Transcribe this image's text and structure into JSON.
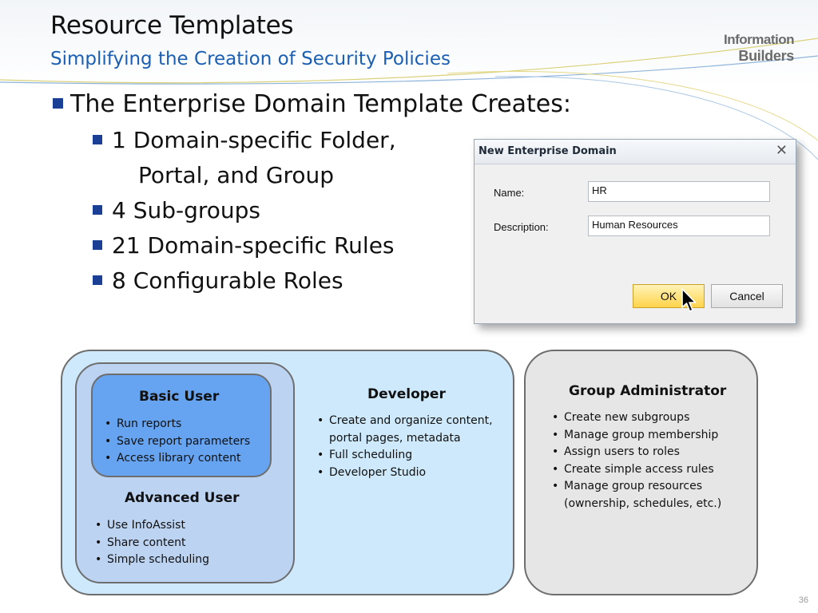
{
  "slide": {
    "title": "Resource Templates",
    "subtitle": "Simplifying the Creation of Security Policies",
    "logo": {
      "line1": "Information",
      "line2": "Builders"
    },
    "page_number": "36",
    "colors": {
      "subtitle": "#1a5fb4",
      "bullet": "#1b3f94"
    }
  },
  "bullets": {
    "main": "The Enterprise Domain Template Creates:",
    "items": [
      {
        "text": "1 Domain-specific Folder,",
        "continuation": "Portal, and Group"
      },
      {
        "text": "4 Sub-groups"
      },
      {
        "text": "21 Domain-specific Rules"
      },
      {
        "text": "8 Configurable Roles"
      }
    ]
  },
  "dialog": {
    "title": "New Enterprise Domain",
    "close_icon": "close-icon",
    "fields": {
      "name_label": "Name:",
      "name_value": "HR",
      "description_label": "Description:",
      "description_value": "Human Resources"
    },
    "buttons": {
      "ok": "OK",
      "cancel": "Cancel"
    }
  },
  "roles": {
    "basic_user": {
      "title": "Basic User",
      "items": [
        "Run reports",
        "Save report parameters",
        "Access library content"
      ]
    },
    "advanced_user": {
      "title": "Advanced User",
      "items": [
        "Use InfoAssist",
        "Share content",
        "Simple scheduling"
      ]
    },
    "developer": {
      "title": "Developer",
      "items": [
        "Create and organize content,",
        "portal pages, metadata",
        "Full scheduling",
        "Developer Studio"
      ]
    },
    "group_administrator": {
      "title": "Group Administrator",
      "items": [
        "Create new subgroups",
        "Manage group membership",
        "Assign users to roles",
        "Create simple access rules",
        "Manage group resources",
        "(ownership, schedules, etc.)"
      ]
    },
    "colors": {
      "basic": "#66a3f0",
      "advanced": "#bcd3f2",
      "developer": "#cde9fb",
      "admin": "#e6e6e6"
    }
  }
}
